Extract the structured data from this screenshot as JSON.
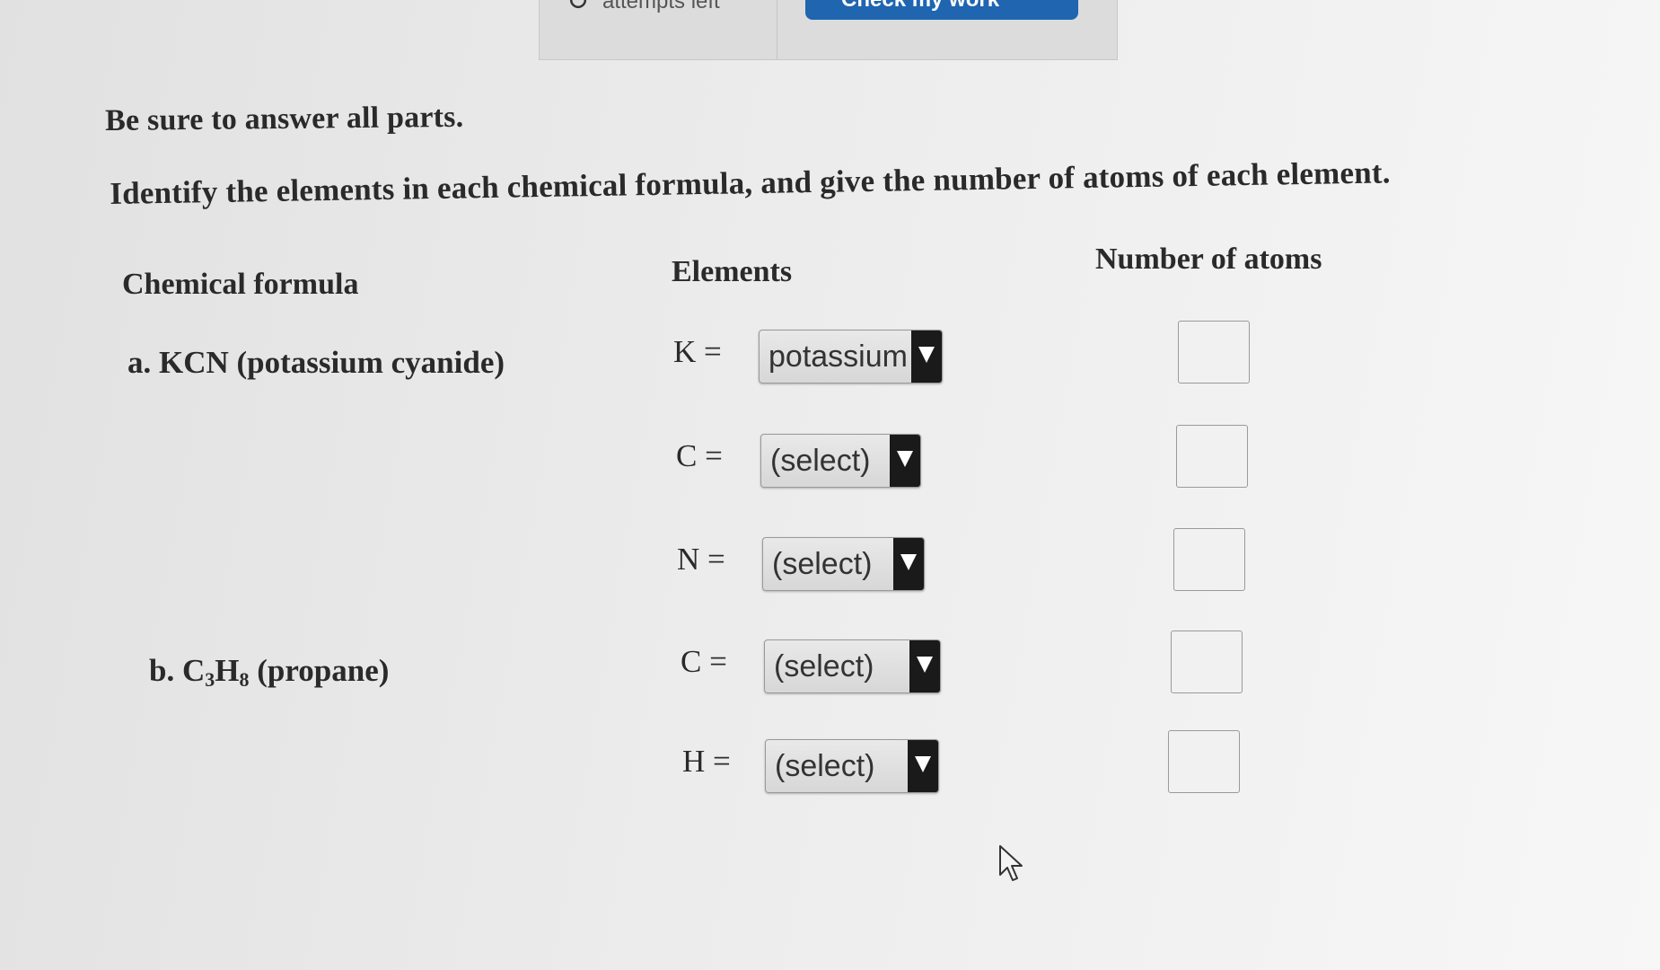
{
  "toolbar": {
    "retry_label": "attempts left",
    "check_label": "Check my work"
  },
  "instructions": {
    "answer_all": "Be sure to answer all parts.",
    "identify": "Identify the elements in each chemical formula, and give the number of atoms of each element."
  },
  "table": {
    "headers": {
      "formula": "Chemical formula",
      "elements": "Elements",
      "atoms": "Number of atoms"
    },
    "formulas": {
      "a": {
        "label": "a. KCN (potassium cyanide)"
      },
      "b": {
        "prefix": "b. C",
        "sub1": "3",
        "middle": "H",
        "sub2": "8",
        "suffix": " (propane)"
      }
    },
    "rows": [
      {
        "symbol": "K =",
        "selected": "potassium",
        "atoms": ""
      },
      {
        "symbol": "C =",
        "selected": "(select)",
        "atoms": ""
      },
      {
        "symbol": "N =",
        "selected": "(select)",
        "atoms": ""
      },
      {
        "symbol": "C =",
        "selected": "(select)",
        "atoms": ""
      },
      {
        "symbol": "H =",
        "selected": "(select)",
        "atoms": ""
      }
    ]
  },
  "icons": {
    "cursor": "mouse-pointer-icon",
    "retry": "retry-icon",
    "dropdown": "chevron-down-icon"
  },
  "colors": {
    "primary_button": "#1f65b0",
    "dropdown_arrow_bg": "#1a1a1a",
    "background": "#ececec"
  }
}
